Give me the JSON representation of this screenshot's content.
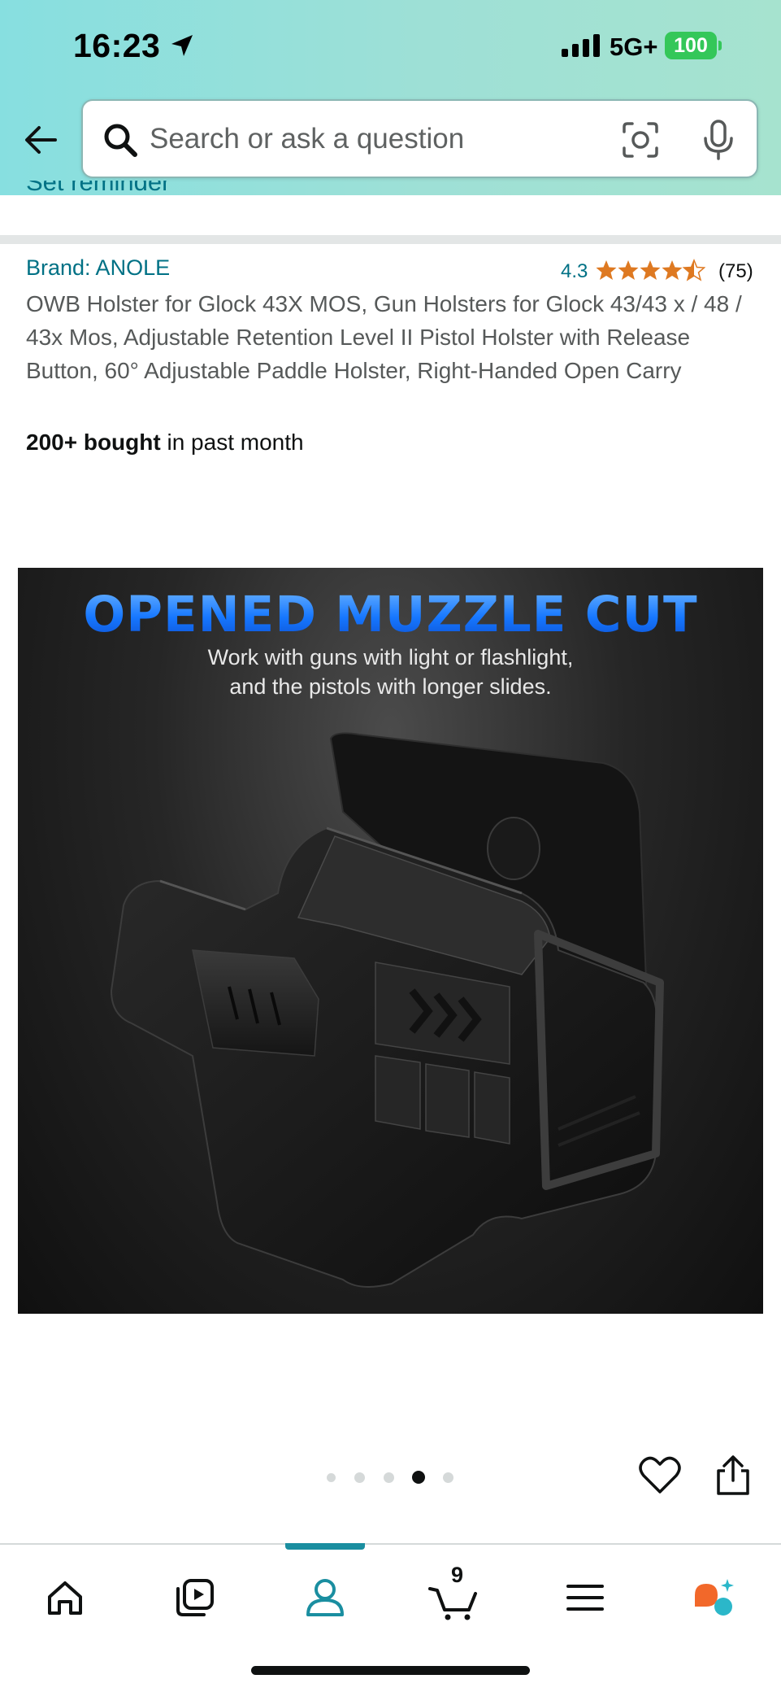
{
  "status_bar": {
    "time": "16:23",
    "network": "5G+",
    "battery": "100",
    "icons": [
      "location-arrow-icon",
      "signal-icon",
      "battery-icon"
    ]
  },
  "search": {
    "placeholder": "Search or ask a question",
    "icons": [
      "back-arrow-icon",
      "search-icon",
      "camera-icon",
      "microphone-icon"
    ]
  },
  "product": {
    "set_reminder": "Set reminder",
    "brand": "Brand: ANOLE",
    "rating": "4.3",
    "rating_value": 4.3,
    "review_count": "(75)",
    "title": "OWB Holster for Glock 43X MOS, Gun Holsters for Glock 43/43 x / 48 / 43x Mos, Adjustable Retention Level II Pistol Holster with Release Button, 60° Adjustable Paddle Holster, Right-Handed Open Carry",
    "bought_bold": "200+ bought",
    "bought_rest": " in past month"
  },
  "image": {
    "headline": "OPENED MUZZLE CUT",
    "subtext_line1": "Work with guns with light or flashlight,",
    "subtext_line2": "and the pistols with longer slides."
  },
  "carousel": {
    "total": 5,
    "active_index": 3
  },
  "bottom_nav": {
    "items": [
      "home-icon",
      "video-icon",
      "account-icon",
      "cart-icon",
      "menu-icon",
      "rufus-icon"
    ],
    "active": "account-icon",
    "cart_count": "9"
  },
  "colors": {
    "header_gradient_start": "#87dfe0",
    "header_gradient_end": "#a6e3cf",
    "link": "#007185",
    "star": "#de7921",
    "battery": "#34c759",
    "nav_active": "#1a8ea0",
    "headline_blue": "#1677ff"
  }
}
